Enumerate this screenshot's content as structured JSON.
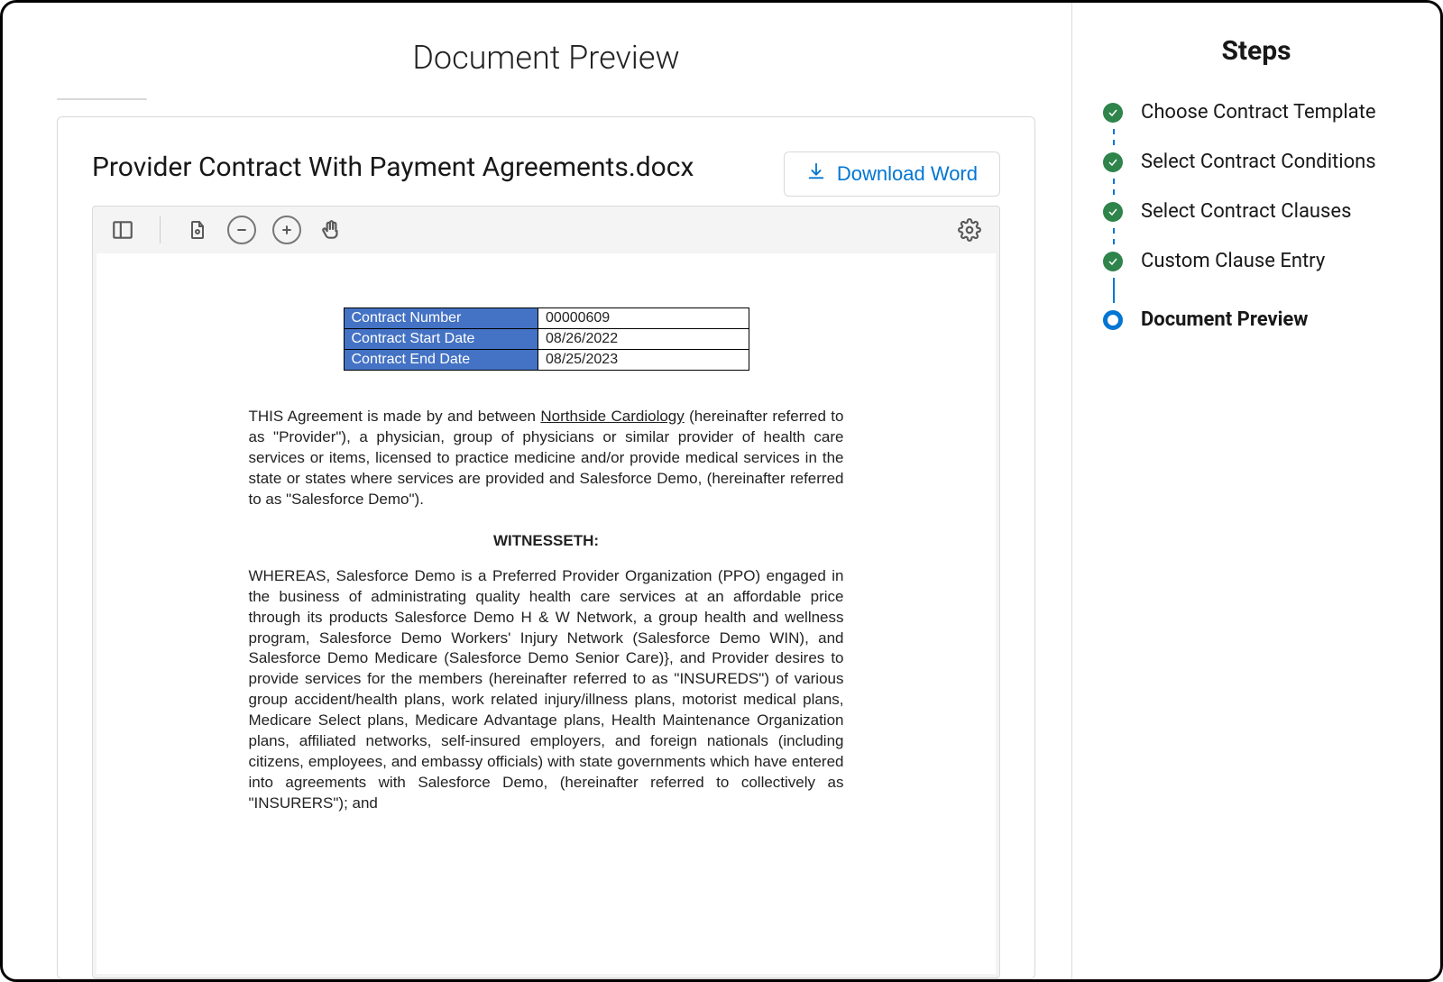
{
  "page": {
    "title": "Document Preview"
  },
  "document": {
    "filename": "Provider Contract With Payment Agreements.docx",
    "download_label": "Download Word"
  },
  "contract": {
    "meta": [
      {
        "label": "Contract Number",
        "value": "00000609"
      },
      {
        "label": "Contract Start Date",
        "value": "08/26/2022"
      },
      {
        "label": "Contract End Date",
        "value": "08/25/2023"
      }
    ],
    "provider_name": "Northside Cardiology",
    "intro_before": "THIS Agreement is made by and between ",
    "intro_after": " (hereinafter referred to as \"Provider\"), a physician, group of physicians or similar provider of health care services or items, licensed to practice medicine and/or provide medical services in the state or states where services are provided and Salesforce Demo, (hereinafter referred to as \"Salesforce Demo\").",
    "witnesseth_label": "WITNESSETH:",
    "whereas": "WHEREAS, Salesforce Demo is a Preferred Provider Organization (PPO) engaged in the business of administrating quality health care services at an affordable price through its products Salesforce Demo H & W Network, a group health and wellness program, Salesforce Demo Workers' Injury Network (Salesforce Demo WIN), and Salesforce Demo Medicare (Salesforce Demo Senior Care)}, and Provider desires to provide services for the members (hereinafter referred to as \"INSUREDS\") of various group accident/health plans, work related injury/illness plans, motorist medical plans, Medicare Select plans, Medicare Advantage plans, Health Maintenance Organization plans, affiliated networks, self-insured employers, and foreign nationals (including citizens, employees, and embassy officials) with state governments which have entered into agreements with Salesforce Demo, (hereinafter referred to collectively as \"INSURERS\"); and"
  },
  "steps": {
    "title": "Steps",
    "items": [
      {
        "label": "Choose Contract Template",
        "state": "done"
      },
      {
        "label": "Select Contract Conditions",
        "state": "done"
      },
      {
        "label": "Select Contract Clauses",
        "state": "done"
      },
      {
        "label": "Custom Clause Entry",
        "state": "done"
      },
      {
        "label": "Document Preview",
        "state": "current"
      }
    ]
  }
}
